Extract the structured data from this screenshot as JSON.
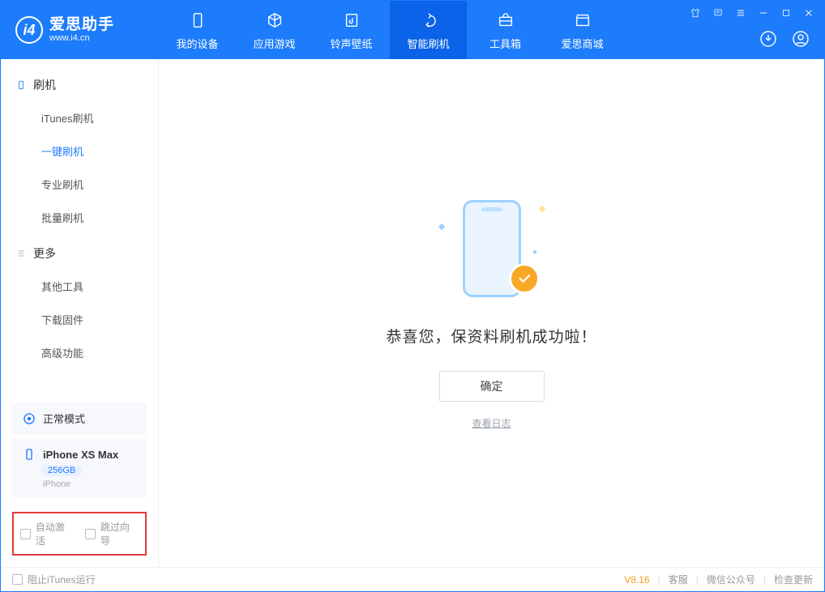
{
  "app": {
    "name_cn": "爱思助手",
    "url": "www.i4.cn"
  },
  "tabs": [
    {
      "label": "我的设备",
      "icon": "phone-icon"
    },
    {
      "label": "应用游戏",
      "icon": "cube-icon"
    },
    {
      "label": "铃声壁纸",
      "icon": "music-note-icon"
    },
    {
      "label": "智能刷机",
      "icon": "refresh-icon"
    },
    {
      "label": "工具箱",
      "icon": "toolbox-icon"
    },
    {
      "label": "爱思商城",
      "icon": "shop-icon"
    }
  ],
  "active_tab_index": 3,
  "sidebar": {
    "group1": {
      "title": "刷机",
      "items": [
        "iTunes刷机",
        "一键刷机",
        "专业刷机",
        "批量刷机"
      ]
    },
    "group2": {
      "title": "更多",
      "items": [
        "其他工具",
        "下载固件",
        "高级功能"
      ]
    },
    "active_item": "一键刷机"
  },
  "mode": {
    "label": "正常模式"
  },
  "device": {
    "name": "iPhone XS Max",
    "storage": "256GB",
    "type": "iPhone"
  },
  "checkboxes": {
    "auto_activate": "自动激活",
    "skip_guide": "跳过向导"
  },
  "main": {
    "success_msg": "恭喜您，保资料刷机成功啦！",
    "ok_label": "确定",
    "log_link": "查看日志"
  },
  "footer": {
    "block_itunes": "阻止iTunes运行",
    "version": "V8.16",
    "links": [
      "客服",
      "微信公众号",
      "检查更新"
    ]
  }
}
